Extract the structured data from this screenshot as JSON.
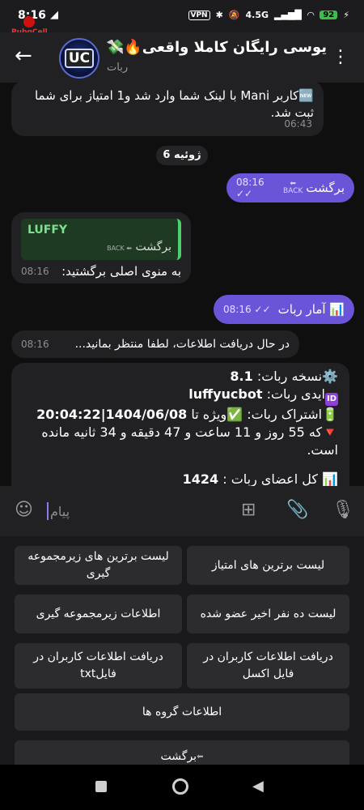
{
  "status_bar": {
    "time": "8:16",
    "vpn_label": "VPN",
    "network": "4.5G",
    "battery": "92",
    "overlay_label": "PubgCell"
  },
  "header": {
    "title": "یوسی رایگان کاملا واقعی🔥💸😍",
    "subtitle": "ربات",
    "avatar_text": "UC"
  },
  "messages": {
    "m1": {
      "text": "🆕کاربر Mani با لینک شما وارد شد و1 امتیاز برای شما ثبت شد.",
      "time": "06:43"
    },
    "date_separator": "6 ژوئیه",
    "m2": {
      "text": "برگشت",
      "time": "08:16",
      "check": "✓✓",
      "arrow_label": "BACK"
    },
    "m3": {
      "reply_name": "LUFFY",
      "reply_text": "برگشت",
      "reply_arrow_label": "BACK",
      "text": "به منوی اصلی برگشتید:",
      "time": "08:16"
    },
    "m4": {
      "text": "📊 آمار ربات",
      "time": "08:16",
      "check": "✓✓"
    },
    "m5": {
      "text": "در حال دریافت اطلاعات، لطفا منتظر بمانید...",
      "time": "08:16"
    },
    "m6": {
      "line1_label": "نسخه ربات:",
      "line1_value": "8.1",
      "line2_label": "ایدی ربات:",
      "line2_value": "luffyucbot",
      "line3_label": "اشتراک ربات:",
      "line3_value": "ویژه تا",
      "line3_date": "20:04:22|1404/06/08",
      "line4": "که 55 روز و 11 ساعت و 47 دقیقه و 34 ثانیه مانده است.",
      "line5_label": "کل اعضای ربات :",
      "line5_value": "1424",
      "icon_gear": "⚙️",
      "icon_id": "ID",
      "icon_battery": "🔋",
      "icon_check": "✅",
      "icon_triangle": "🔻",
      "icon_chart": "📊"
    }
  },
  "composer": {
    "placeholder": "پیام",
    "emoji_icon": "emoji",
    "attach_icon": "paperclip",
    "mic_icon": "microphone",
    "commands_icon": "commands"
  },
  "keyboard": {
    "buttons": [
      "لیست برترین های امتیاز",
      "لیست برترین های زیرمجموعه گیری",
      "لیست ده نفر اخیر عضو شده",
      "اطلاعات زیرمجموعه گیری",
      "دریافت اطلاعات کاربران در فایل اکسل",
      "دریافت اطلاعات کاربران در فایلtxt",
      "اطلاعات گروه ها",
      "برگشت"
    ]
  },
  "colors": {
    "background": "#0f0f10",
    "incoming_bubble": "#212124",
    "outgoing_bubble": "#6a55d8",
    "reply_accent": "#4dd06e",
    "keyboard_button": "#2c2c2f"
  }
}
